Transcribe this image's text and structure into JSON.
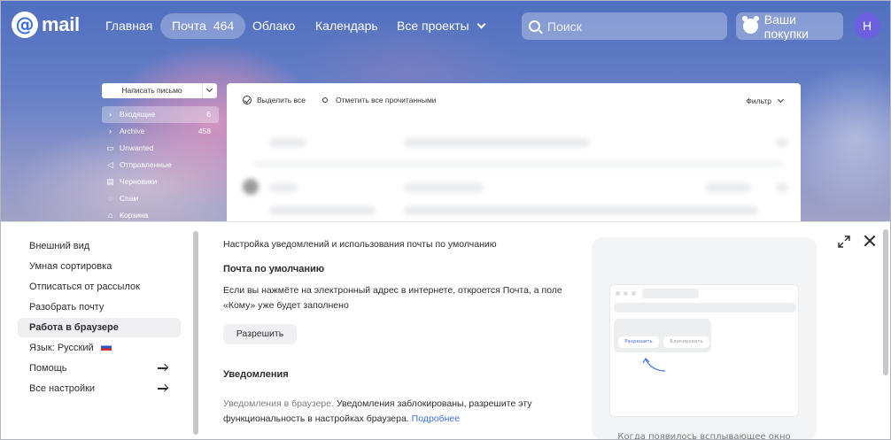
{
  "header": {
    "logo_text": "mail",
    "nav": [
      {
        "label": "Главная"
      },
      {
        "label": "Почта",
        "count": "464"
      },
      {
        "label": "Облако"
      },
      {
        "label": "Календарь"
      },
      {
        "label": "Все проекты"
      }
    ],
    "search_placeholder": "Поиск",
    "purchases_label": "Ваши покупки",
    "avatar_letter": "Н"
  },
  "mail": {
    "compose_label": "Написать письмо",
    "folders": [
      {
        "label": "Входящие",
        "count": "6",
        "icon": "chevron-right-icon"
      },
      {
        "label": "Archive",
        "count": "458",
        "icon": "chevron-right-icon"
      },
      {
        "label": "Unwanted",
        "count": "",
        "icon": "folder-icon"
      },
      {
        "label": "Отправленные",
        "count": "",
        "icon": "sent-icon"
      },
      {
        "label": "Черновики",
        "count": "",
        "icon": "drafts-icon"
      },
      {
        "label": "Спам",
        "count": "",
        "icon": "spam-icon"
      },
      {
        "label": "Корзина",
        "count": "",
        "icon": "trash-icon"
      }
    ],
    "list_toolbar": {
      "select_all": "Выделить все",
      "mark_read": "Отметить все прочитанными",
      "filter": "Фильтр"
    }
  },
  "settings": {
    "menu": [
      {
        "label": "Внешний вид"
      },
      {
        "label": "Умная сортировка"
      },
      {
        "label": "Отписаться от рассылок"
      },
      {
        "label": "Разобрать почту"
      },
      {
        "label": "Работа в браузере"
      },
      {
        "label": "Язык: Русский"
      },
      {
        "label": "Помощь"
      },
      {
        "label": "Все настройки"
      }
    ],
    "subtitle": "Настройка уведомлений и использования почты по умолчанию",
    "default_mail_title": "Почта по умолчанию",
    "default_mail_text": "Если вы нажмёте на электронный адрес в интернете, откроется Почта, а поле «Кому» уже будет заполнено",
    "allow_button": "Разрешить",
    "notifications_title": "Уведомления",
    "notifications_muted": "Уведомления в браузере.",
    "notifications_text": " Уведомления заблокированы, разрешите эту функциональность в настройках браузера.",
    "notifications_link": "Подробнее",
    "illustration": {
      "allow": "Разрешить",
      "block": "Блокировать",
      "caption": "Когда появилось всплывающее окно"
    }
  },
  "colors": {
    "accent": "#3d6fe0",
    "avatar": "#6c5fe0"
  }
}
